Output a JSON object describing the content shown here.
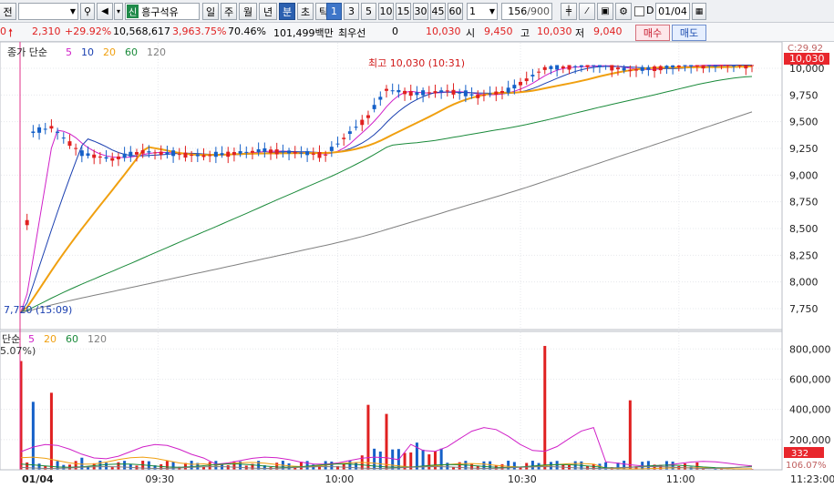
{
  "toolbar": {
    "left_label": "전",
    "stock_name": "흥구석유",
    "stock_badge": "신",
    "period_buttons": [
      "일",
      "주",
      "월",
      "년",
      "분",
      "초",
      "틱"
    ],
    "active_period": "분",
    "interval_buttons": [
      "1",
      "3",
      "5",
      "10",
      "15",
      "30",
      "45",
      "60"
    ],
    "active_interval": "1",
    "interval_select": "1",
    "count": "156",
    "count_total": "/900",
    "date_label": "D",
    "date_value": "01/04"
  },
  "quote": {
    "price": "0",
    "change": "2,310",
    "change_pct": "+29.92%",
    "volume": "10,568,617",
    "volume_ratio": "3,963.75%",
    "turnover_ratio": "70.46%",
    "amount": "101,499백만",
    "best_bid_label": "최우선",
    "best_bid": "0",
    "current": "10,030",
    "open_label": "시",
    "open": "9,450",
    "high_label": "고",
    "high": "10,030",
    "low_label": "저",
    "low": "9,040",
    "buy_button": "매수",
    "sell_button": "매도"
  },
  "price_panel": {
    "legend_prefix": "종가 단순",
    "legend_ma": [
      {
        "label": "5",
        "color": "#d020c8"
      },
      {
        "label": "10",
        "color": "#1a3fb0"
      },
      {
        "label": "20",
        "color": "#f0a010"
      },
      {
        "label": "60",
        "color": "#1a8a3a"
      },
      {
        "label": "120",
        "color": "#808080"
      }
    ],
    "high_annotation": "최고 10,030 (10:31)",
    "low_annotation": "7,720 (15:09)",
    "y_ticks": [
      "10,000",
      "9,750",
      "9,500",
      "9,250",
      "9,000",
      "8,750",
      "8,500",
      "8,250",
      "8,000",
      "7,750"
    ],
    "current_tag": "10,030",
    "upper_tag": "C:29.92"
  },
  "volume_panel": {
    "legend_prefix": "단순",
    "legend_ma": [
      {
        "label": "5",
        "color": "#d020c8"
      },
      {
        "label": "20",
        "color": "#f0a010"
      },
      {
        "label": "60",
        "color": "#1a8a3a"
      },
      {
        "label": "120",
        "color": "#808080"
      }
    ],
    "pct_label": "5.07%)",
    "y_ticks": [
      "800,000",
      "600,000",
      "400,000",
      "200,000"
    ],
    "current_tag": "332",
    "bottom_tag": "106.07%"
  },
  "x_axis": {
    "ticks": [
      "01/04",
      "09:30",
      "10:00",
      "10:30",
      "11:00"
    ],
    "right_time": "11:23:00"
  },
  "colors": {
    "up": "#e02020",
    "down": "#1560c8",
    "accent": "#3e76c9"
  },
  "chart_data": {
    "type": "candlestick",
    "x_labels": [
      "01/04",
      "09:30",
      "10:00",
      "10:30",
      "11:00"
    ],
    "ylim": [
      7600,
      10150
    ],
    "price_series": [
      {
        "t": 0,
        "o": 7720,
        "h": 7720,
        "l": 7720,
        "c": 7720
      },
      {
        "t": 2,
        "o": 9350,
        "h": 9450,
        "l": 9250,
        "c": 9400
      },
      {
        "t": 5,
        "o": 9300,
        "h": 9550,
        "l": 9250,
        "c": 9450
      },
      {
        "t": 10,
        "o": 9250,
        "h": 9320,
        "l": 9100,
        "c": 9200
      },
      {
        "t": 15,
        "o": 9120,
        "h": 9200,
        "l": 9050,
        "c": 9150
      },
      {
        "t": 20,
        "o": 9200,
        "h": 9390,
        "l": 9150,
        "c": 9220
      },
      {
        "t": 30,
        "o": 9200,
        "h": 9260,
        "l": 9120,
        "c": 9180
      },
      {
        "t": 40,
        "o": 9200,
        "h": 9280,
        "l": 9130,
        "c": 9230
      },
      {
        "t": 50,
        "o": 9180,
        "h": 9240,
        "l": 9140,
        "c": 9190
      },
      {
        "t": 57,
        "o": 9180,
        "h": 9580,
        "l": 9160,
        "c": 9550
      },
      {
        "t": 60,
        "o": 9750,
        "h": 9850,
        "l": 9600,
        "c": 9800
      },
      {
        "t": 65,
        "o": 9800,
        "h": 9900,
        "l": 9680,
        "c": 9760
      },
      {
        "t": 70,
        "o": 9750,
        "h": 9830,
        "l": 9700,
        "c": 9790
      },
      {
        "t": 75,
        "o": 9760,
        "h": 9810,
        "l": 9710,
        "c": 9740
      },
      {
        "t": 80,
        "o": 9760,
        "h": 9820,
        "l": 9720,
        "c": 9790
      },
      {
        "t": 86,
        "o": 9850,
        "h": 10030,
        "l": 9800,
        "c": 10000
      },
      {
        "t": 95,
        "o": 10030,
        "h": 10030,
        "l": 10000,
        "c": 10030
      },
      {
        "t": 100,
        "o": 10020,
        "h": 10030,
        "l": 9920,
        "c": 9980
      },
      {
        "t": 110,
        "o": 10030,
        "h": 10030,
        "l": 10010,
        "c": 10030
      },
      {
        "t": 120,
        "o": 10030,
        "h": 10030,
        "l": 10030,
        "c": 10030
      }
    ],
    "volume_series": [
      {
        "t": 0,
        "v": 720000
      },
      {
        "t": 2,
        "v": 450000
      },
      {
        "t": 5,
        "v": 510000
      },
      {
        "t": 10,
        "v": 80000
      },
      {
        "t": 20,
        "v": 60000
      },
      {
        "t": 40,
        "v": 30000
      },
      {
        "t": 57,
        "v": 430000
      },
      {
        "t": 60,
        "v": 370000
      },
      {
        "t": 65,
        "v": 180000
      },
      {
        "t": 80,
        "v": 60000
      },
      {
        "t": 86,
        "v": 820000
      },
      {
        "t": 95,
        "v": 40000
      },
      {
        "t": 100,
        "v": 460000
      },
      {
        "t": 110,
        "v": 20000
      },
      {
        "t": 120,
        "v": 332
      }
    ],
    "volume_ylim": [
      0,
      880000
    ]
  }
}
